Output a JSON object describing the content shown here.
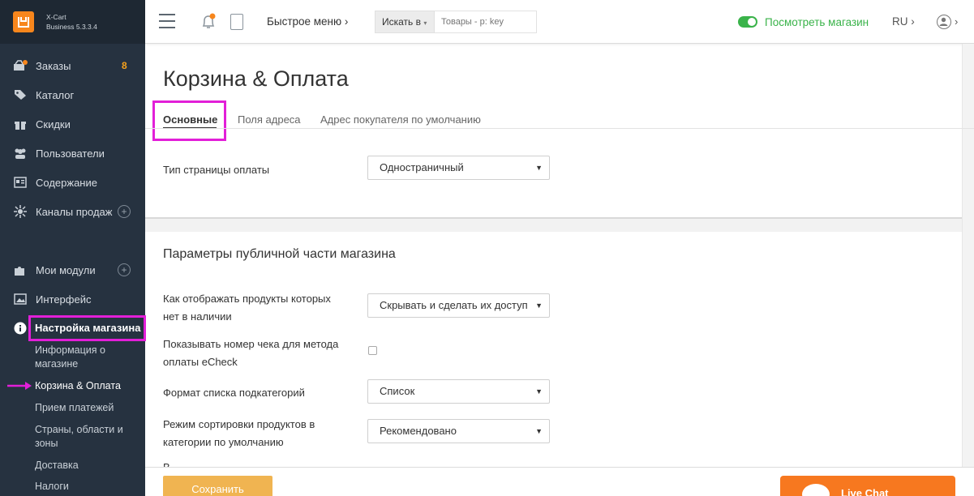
{
  "brand": {
    "name": "X-Cart",
    "edition": "Business 5.3.3.4"
  },
  "sidebar": {
    "items": [
      {
        "label": "Заказы",
        "badge": "8",
        "icon": "cart-icon"
      },
      {
        "label": "Каталог",
        "icon": "tag-icon"
      },
      {
        "label": "Скидки",
        "icon": "gift-icon"
      },
      {
        "label": "Пользователи",
        "icon": "users-icon"
      },
      {
        "label": "Содержание",
        "icon": "content-icon"
      },
      {
        "label": "Каналы продаж",
        "icon": "channels-icon"
      },
      {
        "label": "Мои модули",
        "icon": "puzzle-icon"
      },
      {
        "label": "Интерфейс",
        "icon": "image-icon"
      },
      {
        "label": "Настройка магазина",
        "icon": "info-icon"
      }
    ],
    "subitems": [
      "Информация о магазине",
      "Корзина & Оплата",
      "Прием платежей",
      "Страны, области и зоны",
      "Доставка",
      "Налоги"
    ]
  },
  "topbar": {
    "quick_menu": "Быстрое меню ›",
    "search_scope": "Искать в",
    "search_placeholder": "Товары - р: key",
    "view_store": "Посмотреть магазин",
    "language": "RU ›"
  },
  "page": {
    "title": "Корзина & Оплата",
    "tabs": [
      "Основные",
      "Поля адреса",
      "Адрес покупателя по умолчанию"
    ],
    "active_tab": 0
  },
  "checkout": {
    "page_type_label": "Тип страницы оплаты",
    "page_type_value": "Одностраничный"
  },
  "storefront": {
    "section_title": "Параметры публичной части магазина",
    "out_of_stock_label": "Как отображать продукты которых нет в наличии",
    "out_of_stock_value": "Скрывать и сделать их доступ",
    "echeck_label": "Показывать номер чека для метода оплаты eCheck",
    "echeck_checked": false,
    "subcat_label": "Формат списка подкатегорий",
    "subcat_value": "Список",
    "sort_label": "Режим сортировки продуктов в категории по умолчанию",
    "sort_value": "Рекомендовано",
    "next_label_fragment": "В"
  },
  "footer": {
    "save_label": "Сохранить",
    "livechat_label": "Live Chat"
  },
  "colors": {
    "sidebar_bg": "#263240",
    "accent_orange": "#f7861c",
    "highlight_magenta": "#e21fd8",
    "store_green": "#3ab34a",
    "save_button": "#f0b451",
    "livechat": "#f7781f"
  }
}
